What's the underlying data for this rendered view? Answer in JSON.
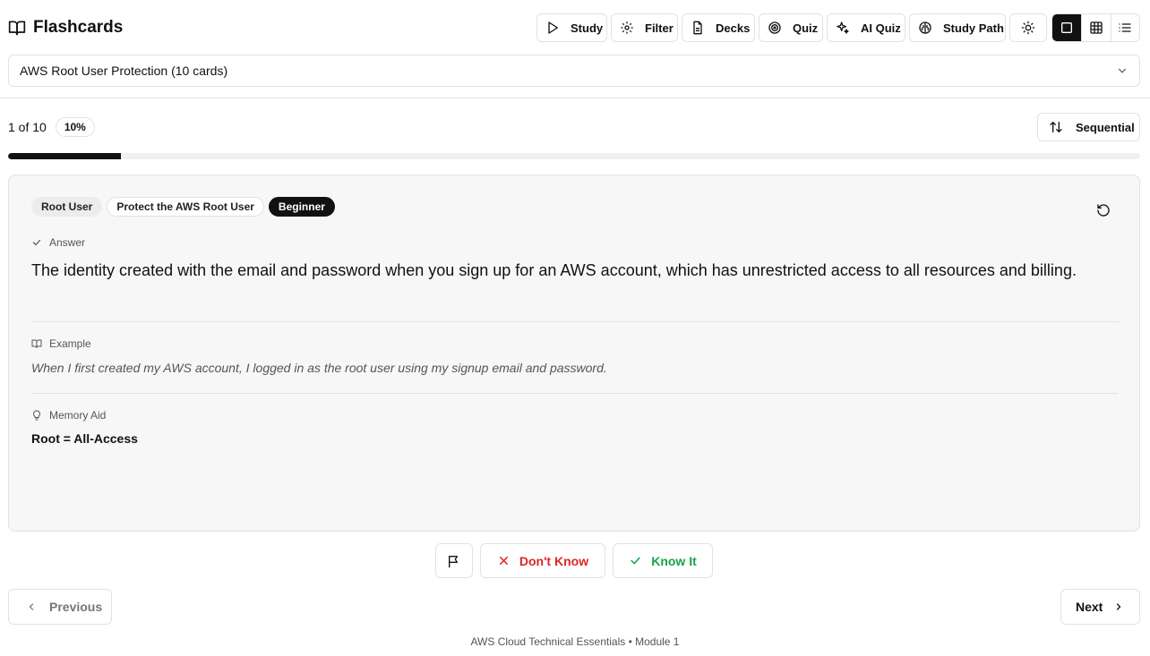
{
  "header": {
    "app_title": "Flashcards",
    "toolbar": [
      {
        "label": "Study",
        "icon": "play-icon"
      },
      {
        "label": "Filter",
        "icon": "gear-icon"
      },
      {
        "label": "Decks",
        "icon": "file-icon"
      },
      {
        "label": "Quiz",
        "icon": "target-icon"
      },
      {
        "label": "AI Quiz",
        "icon": "sparkles-icon"
      },
      {
        "label": "Study Path",
        "icon": "brain-icon"
      }
    ],
    "theme_toggle_icon": "sun-icon",
    "view_modes": [
      "single-card-view",
      "grid-view",
      "list-view"
    ],
    "active_view_mode": "single-card-view"
  },
  "deck_selector": {
    "selected": "AWS Root User Protection (10 cards)"
  },
  "progress": {
    "counter": "1 of 10",
    "percent_label": "10%",
    "fraction": 0.1,
    "sort_label": "Sequential"
  },
  "card": {
    "tags": [
      "Root User",
      "Protect the AWS Root User",
      "Beginner"
    ],
    "answer_label": "Answer",
    "answer_text": "The identity created with the email and password when you sign up for an AWS account, which has unrestricted access to all resources and billing.",
    "example_label": "Example",
    "example_text": "When I first created my AWS account, I logged in as the root user using my signup email and password.",
    "memory_label": "Memory Aid",
    "memory_text": "Root = All-Access"
  },
  "actions": {
    "dont_know": "Don't Know",
    "know_it": "Know It"
  },
  "navigation": {
    "previous": "Previous",
    "next": "Next"
  },
  "footer": {
    "text": "AWS Cloud Technical Essentials • Module 1"
  },
  "colors": {
    "accent": "#111111",
    "danger": "#dc2626",
    "success": "#16a34a",
    "card_bg": "#f7f7f7",
    "border": "#e2e2e2"
  }
}
